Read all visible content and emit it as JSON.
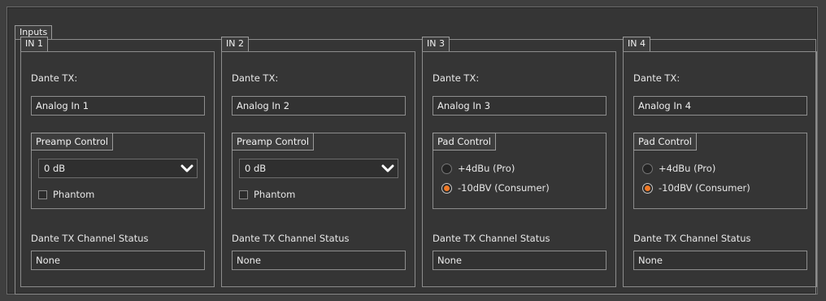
{
  "inputs_label": "Inputs",
  "dante_tx_label": "Dante TX:",
  "status_label": "Dante TX Channel Status",
  "accent_color": "#f07a28",
  "channels": [
    {
      "name": "IN 1",
      "tx_name": "Analog In 1",
      "control_title": "Preamp Control",
      "gain": "0 dB",
      "phantom_label": "Phantom",
      "phantom_checked": false,
      "status": "None"
    },
    {
      "name": "IN 2",
      "tx_name": "Analog In 2",
      "control_title": "Preamp Control",
      "gain": "0 dB",
      "phantom_label": "Phantom",
      "phantom_checked": false,
      "status": "None"
    },
    {
      "name": "IN 3",
      "tx_name": "Analog In 3",
      "control_title": "Pad Control",
      "pad_options": [
        "+4dBu (Pro)",
        "-10dBV (Consumer)"
      ],
      "pad_selected": 1,
      "status": "None"
    },
    {
      "name": "IN 4",
      "tx_name": "Analog In 4",
      "control_title": "Pad Control",
      "pad_options": [
        "+4dBu (Pro)",
        "-10dBV (Consumer)"
      ],
      "pad_selected": 1,
      "status": "None"
    }
  ]
}
